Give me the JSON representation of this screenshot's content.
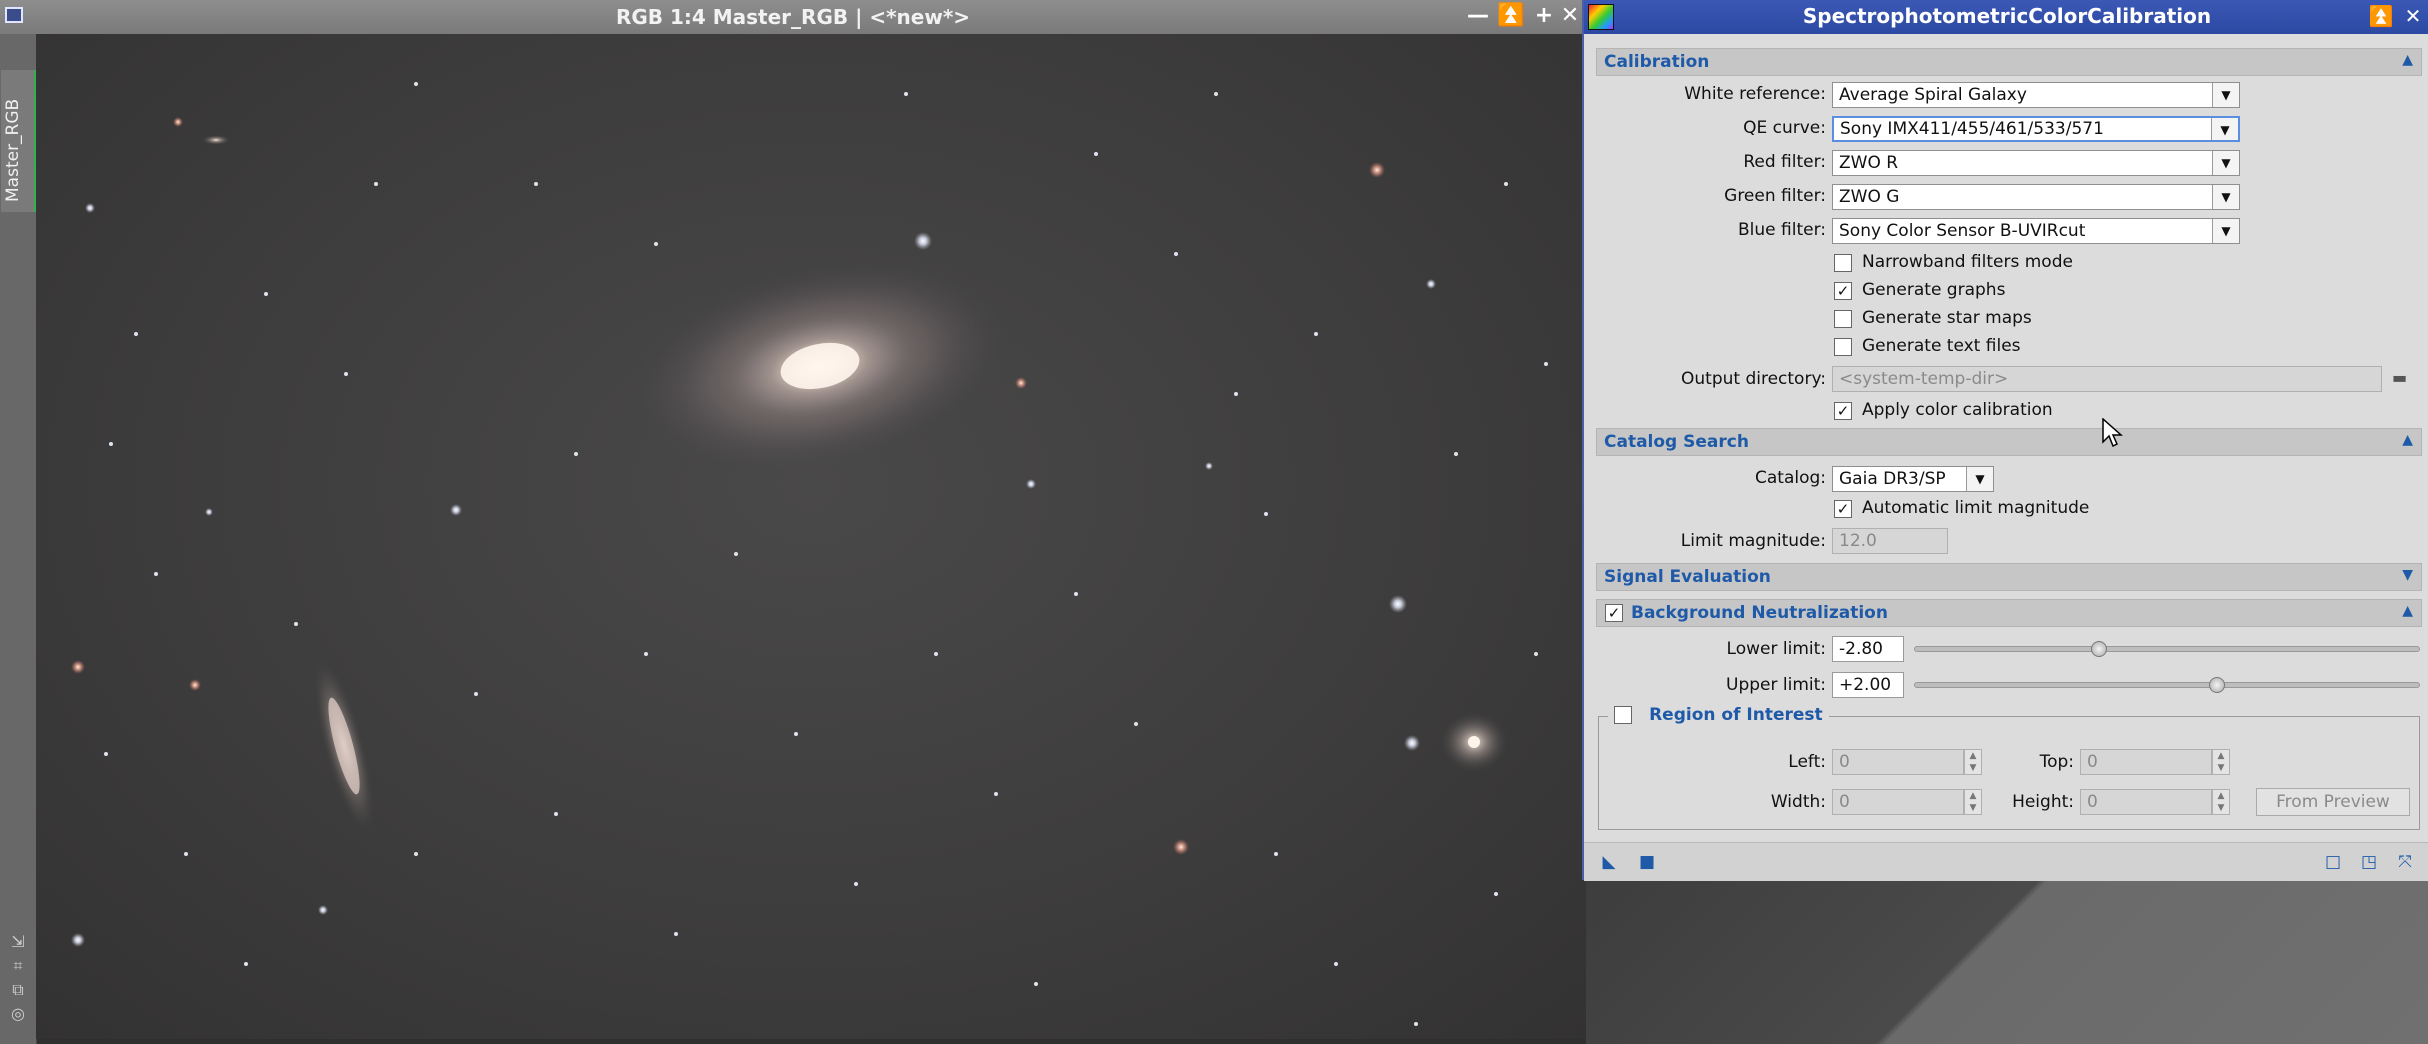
{
  "image_window": {
    "title": "RGB 1:4 Master_RGB | <*new*>",
    "side_tab_label": "Master_RGB",
    "controls": {
      "minimize": "—",
      "shade": "⏫",
      "maximize": "+",
      "close": "✕"
    }
  },
  "dialog": {
    "title": "SpectrophotometricColorCalibration",
    "controls": {
      "shade": "⏫",
      "close": "✕"
    },
    "calibration": {
      "header": "Calibration",
      "white_reference_label": "White reference:",
      "white_reference_value": "Average Spiral Galaxy",
      "qe_curve_label": "QE curve:",
      "qe_curve_value": "Sony IMX411/455/461/533/571",
      "red_filter_label": "Red filter:",
      "red_filter_value": "ZWO R",
      "green_filter_label": "Green filter:",
      "green_filter_value": "ZWO G",
      "blue_filter_label": "Blue filter:",
      "blue_filter_value": "Sony Color Sensor B-UVIRcut",
      "narrowband_label": "Narrowband filters mode",
      "narrowband_checked": false,
      "generate_graphs_label": "Generate graphs",
      "generate_graphs_checked": true,
      "generate_star_maps_label": "Generate star maps",
      "generate_star_maps_checked": false,
      "generate_text_files_label": "Generate text files",
      "generate_text_files_checked": false,
      "output_directory_label": "Output directory:",
      "output_directory_placeholder": "<system-temp-dir>",
      "apply_color_calibration_label": "Apply color calibration",
      "apply_color_calibration_checked": true
    },
    "catalog_search": {
      "header": "Catalog Search",
      "catalog_label": "Catalog:",
      "catalog_value": "Gaia DR3/SP",
      "auto_limit_label": "Automatic limit magnitude",
      "auto_limit_checked": true,
      "limit_magnitude_label": "Limit magnitude:",
      "limit_magnitude_value": "12.0"
    },
    "signal_evaluation": {
      "header": "Signal Evaluation"
    },
    "background_neutralization": {
      "header": "Background Neutralization",
      "enabled": true,
      "lower_limit_label": "Lower limit:",
      "lower_limit_value": "-2.80",
      "lower_limit_slider_fraction": 0.36,
      "upper_limit_label": "Upper limit:",
      "upper_limit_value": "+2.00",
      "upper_limit_slider_fraction": 0.6
    },
    "region_of_interest": {
      "header": "Region of Interest",
      "enabled": false,
      "left_label": "Left:",
      "left_value": "0",
      "top_label": "Top:",
      "top_value": "0",
      "width_label": "Width:",
      "width_value": "0",
      "height_label": "Height:",
      "height_value": "0",
      "from_preview_label": "From Preview"
    }
  },
  "colors": {
    "section_header_text": "#1e5aa8",
    "dialog_titlebar": "#2c49a3",
    "image_titlebar": "#7a7a7a",
    "active_tab_indicator": "#2fb34a"
  }
}
